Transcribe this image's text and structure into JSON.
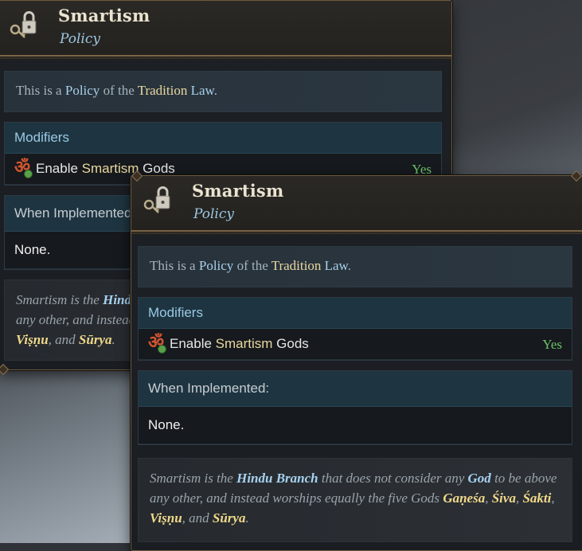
{
  "tooltips": [
    {
      "title": "Smartism",
      "subtitle": "Policy",
      "desc": {
        "pre": "This is a ",
        "policy": "Policy",
        "mid": " of the ",
        "tradition": "Tradition",
        "law": " Law",
        "end": "."
      },
      "modifiers_label": "Modifiers",
      "modifier": {
        "pre": "Enable ",
        "highlight": "Smartism",
        "post": " Gods",
        "value": "Yes"
      },
      "implemented_label": "When Implemented:",
      "implemented_value": "None.",
      "flavor": {
        "p1": "Smartism is the ",
        "branch": "Hindu Branch",
        "p2": " that does not consider any ",
        "god": "God",
        "p3": " to be above any other, and instead worships equally the five Gods ",
        "g1": "Gaṇeśa",
        "c1": ", ",
        "g2": "Śiva",
        "c2": ", ",
        "g3": "Śakti",
        "c3": ", ",
        "g4": "Viṣṇu",
        "c4": ", and ",
        "g5": "Sūrya",
        "end": "."
      }
    }
  ],
  "colors": {
    "keyword_blue": "#a9d0ea",
    "keyword_gold": "#e9d8a0",
    "yes_green": "#6ac26a",
    "om_red": "#d2552f"
  },
  "icons": {
    "header": "key-lock-icon",
    "modifier": "om-icon"
  }
}
